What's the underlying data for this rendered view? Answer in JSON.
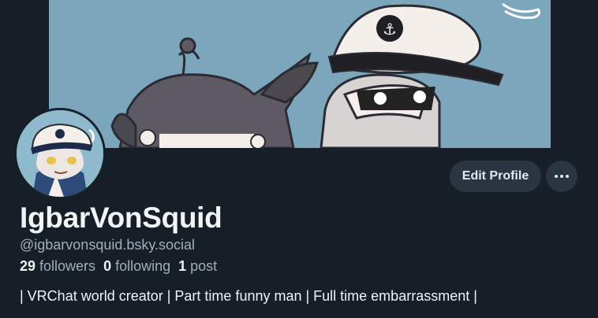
{
  "profile": {
    "display_name": "IgbarVonSquid",
    "handle": "@igbarvonsquid.bsky.social",
    "bio": "| VRChat world creator | Part time funny man | Full time embarrassment |"
  },
  "stats": {
    "followers_count": "29",
    "followers_label": "followers",
    "following_count": "0",
    "following_label": "following",
    "posts_count": "1",
    "posts_label": "post"
  },
  "actions": {
    "edit_profile_label": "Edit Profile",
    "more_icon": "ellipsis-horizontal-icon"
  },
  "colors": {
    "background": "#161e27",
    "button_bg": "#2a3542",
    "text_primary": "#f1f3f5",
    "text_secondary": "#a2aebb",
    "banner_bg": "#7ba6bb"
  }
}
